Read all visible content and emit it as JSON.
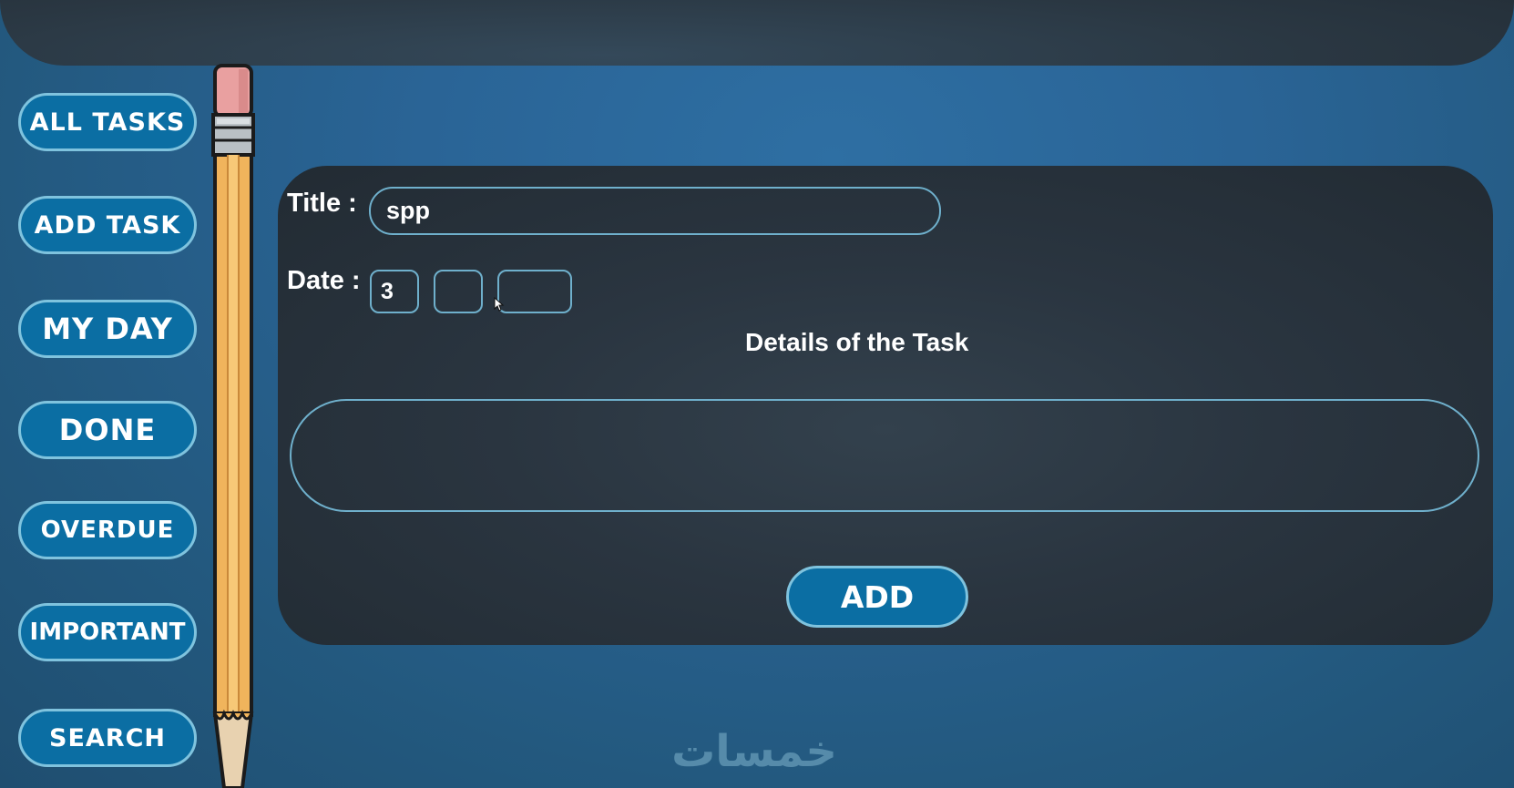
{
  "sidebar": {
    "items": [
      {
        "label": "ALL  TASKS"
      },
      {
        "label": "ADD  TASK"
      },
      {
        "label": "MY  DAY"
      },
      {
        "label": "DONE"
      },
      {
        "label": "OVERDUE"
      },
      {
        "label": "IMPORTANT"
      },
      {
        "label": "SEARCH"
      }
    ]
  },
  "form": {
    "title_label": "Title :",
    "title_value": "spp",
    "date_label": "Date :",
    "date_day": "3",
    "date_month": "",
    "date_year": "",
    "details_heading": "Details of the Task",
    "details_value": "",
    "add_label": "ADD"
  },
  "watermark": {
    "text": "خمسات"
  },
  "colors": {
    "button_fill": "#0b6ea3",
    "button_border": "#7fc3de",
    "panel_bg": "#2a3540",
    "page_bg": "#2a6496"
  },
  "icons": {
    "divider": "pencil-icon",
    "cursor": "mouse-pointer-icon"
  }
}
